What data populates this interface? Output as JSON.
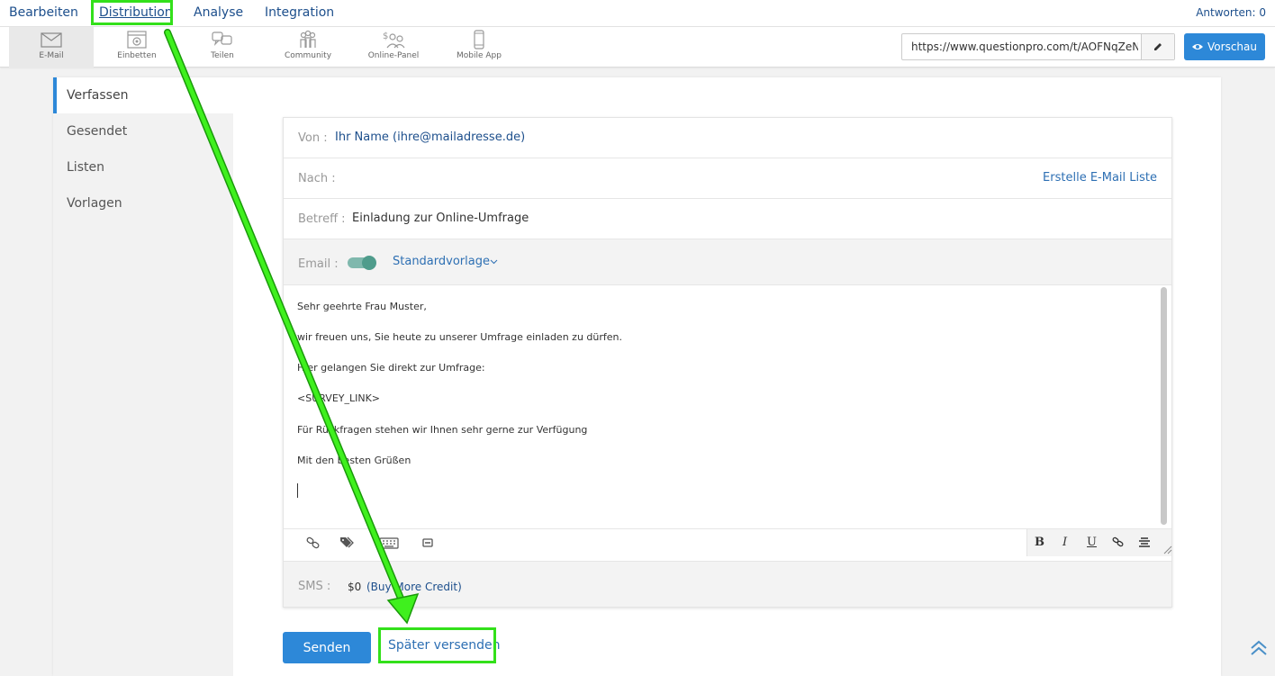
{
  "topnav": {
    "items": [
      "Bearbeiten",
      "Distribution",
      "Analyse",
      "Integration"
    ],
    "answers": "Antworten: 0"
  },
  "toolbar": {
    "tools": [
      {
        "label": "E-Mail",
        "icon": "envelope-icon"
      },
      {
        "label": "Einbetten",
        "icon": "embed-icon"
      },
      {
        "label": "Teilen",
        "icon": "share-icon"
      },
      {
        "label": "Community",
        "icon": "community-icon"
      },
      {
        "label": "Online-Panel",
        "icon": "online-panel-icon"
      },
      {
        "label": "Mobile App",
        "icon": "mobile-icon"
      }
    ],
    "url": "https://www.questionpro.com/t/AOFNqZeNSa",
    "preview_label": "Vorschau"
  },
  "sidenav": {
    "items": [
      "Verfassen",
      "Gesendet",
      "Listen",
      "Vorlagen"
    ],
    "active": "Verfassen"
  },
  "form": {
    "from_label": "Von :",
    "from_value": "Ihr Name (ihre@mailadresse.de)",
    "to_label": "Nach :",
    "create_list_link": "Erstelle E-Mail Liste",
    "subject_label": "Betreff :",
    "subject_value": "Einladung zur Online-Umfrage",
    "email_label": "Email :",
    "email_toggle_on": true,
    "template_label": "Standardvorlage",
    "body_lines": [
      "Sehr geehrte Frau Muster,",
      "wir freuen uns, Sie heute zu unserer Umfrage einladen zu dürfen.",
      "Hier gelangen Sie direkt zur Umfrage:",
      "<SURVEY_LINK>",
      "Für Rückfragen stehen wir Ihnen sehr gerne zur Verfügung",
      "Mit den besten Grüßen"
    ],
    "format_buttons": [
      "B",
      "I",
      "U"
    ],
    "sms_label": "SMS :",
    "sms_credit": "$0",
    "buy_credit_link": "(Buy More Credit)"
  },
  "actions": {
    "send_label": "Senden",
    "later_label": "Später versenden"
  },
  "colors": {
    "accent": "#2d88d8",
    "link": "#1d4f8c",
    "highlight": "#33e01a",
    "toggle": "#4f9c8c"
  }
}
